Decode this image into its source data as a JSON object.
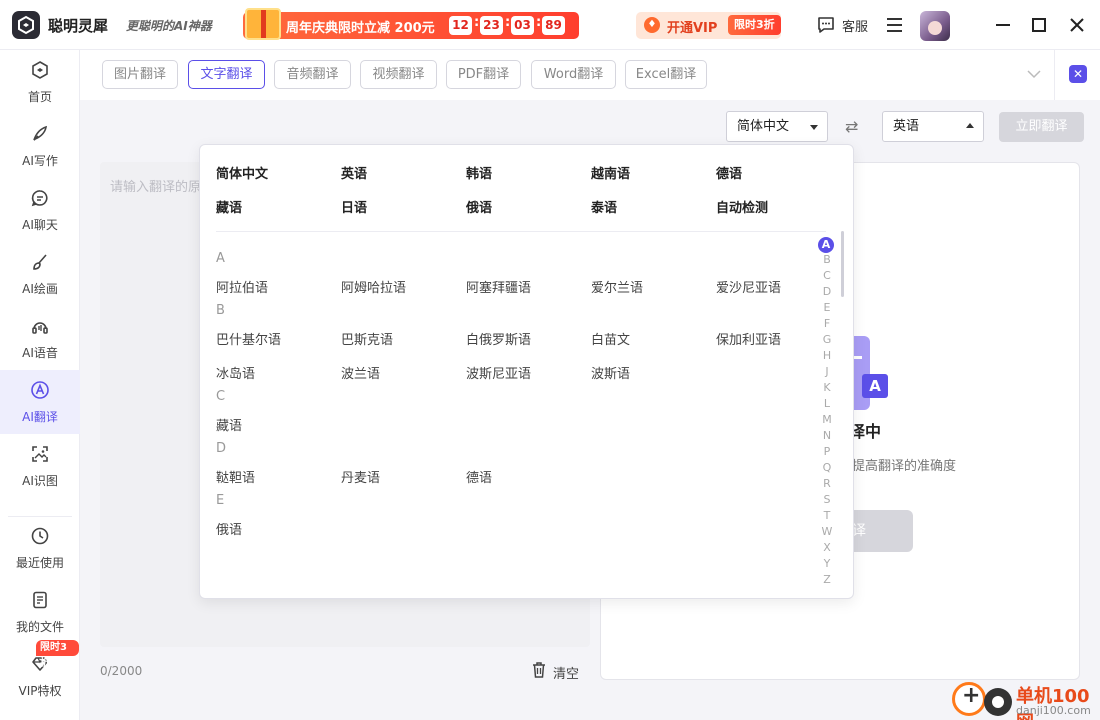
{
  "app": {
    "name": "聪明灵犀",
    "slogan": "更聪明的AI神器"
  },
  "promo": {
    "text": "周年庆典限时立减 200元",
    "timer": [
      "12",
      "23",
      "03",
      "89"
    ]
  },
  "vip": {
    "label": "开通VIP",
    "tag": "限时3折"
  },
  "header": {
    "service_label": "客服"
  },
  "sidebar": {
    "items": [
      {
        "label": "首页"
      },
      {
        "label": "AI写作"
      },
      {
        "label": "AI聊天"
      },
      {
        "label": "AI绘画"
      },
      {
        "label": "AI语音"
      },
      {
        "label": "AI翻译"
      },
      {
        "label": "AI识图"
      },
      {
        "label": "最近使用"
      },
      {
        "label": "我的文件"
      },
      {
        "label": "VIP特权"
      }
    ],
    "vip_badge": "限时3折"
  },
  "tabs": [
    "图片翻译",
    "文字翻译",
    "音频翻译",
    "视频翻译",
    "PDF翻译",
    "Word翻译",
    "Excel翻译"
  ],
  "active_tab": "文字翻译",
  "lang_bar": {
    "source": "简体中文",
    "target": "英语",
    "translate_button": "立即翻译"
  },
  "input": {
    "placeholder": "请输入翻译的原",
    "count": "0/2000",
    "clear_label": "清空"
  },
  "output": {
    "title": "译中",
    "subtitle": "提高翻译的准确度",
    "button": "译"
  },
  "dropdown": {
    "common": [
      "简体中文",
      "英语",
      "韩语",
      "越南语",
      "德语",
      "藏语",
      "日语",
      "俄语",
      "泰语",
      "自动检测"
    ],
    "groups": [
      {
        "letter": "A",
        "langs": [
          "阿拉伯语",
          "阿姆哈拉语",
          "阿塞拜疆语",
          "爱尔兰语",
          "爱沙尼亚语"
        ]
      },
      {
        "letter": "B",
        "langs": [
          "巴什基尔语",
          "巴斯克语",
          "白俄罗斯语",
          "白苗文",
          "保加利亚语",
          "冰岛语",
          "波兰语",
          "波斯尼亚语",
          "波斯语"
        ]
      },
      {
        "letter": "C",
        "langs": [
          "藏语"
        ]
      },
      {
        "letter": "D",
        "langs": [
          "鞑靼语",
          "丹麦语",
          "德语"
        ]
      },
      {
        "letter": "E",
        "langs": [
          "俄语"
        ]
      }
    ],
    "alphabet": [
      "A",
      "B",
      "C",
      "D",
      "E",
      "F",
      "G",
      "H",
      "J",
      "K",
      "L",
      "M",
      "N",
      "P",
      "Q",
      "R",
      "S",
      "T",
      "W",
      "X",
      "Y",
      "Z"
    ],
    "active_letter": "A"
  },
  "watermark": {
    "title": "单机100网",
    "url": "danji100.com"
  },
  "colors": {
    "accent": "#5b4fe8",
    "promo": "#ff3e2e"
  }
}
